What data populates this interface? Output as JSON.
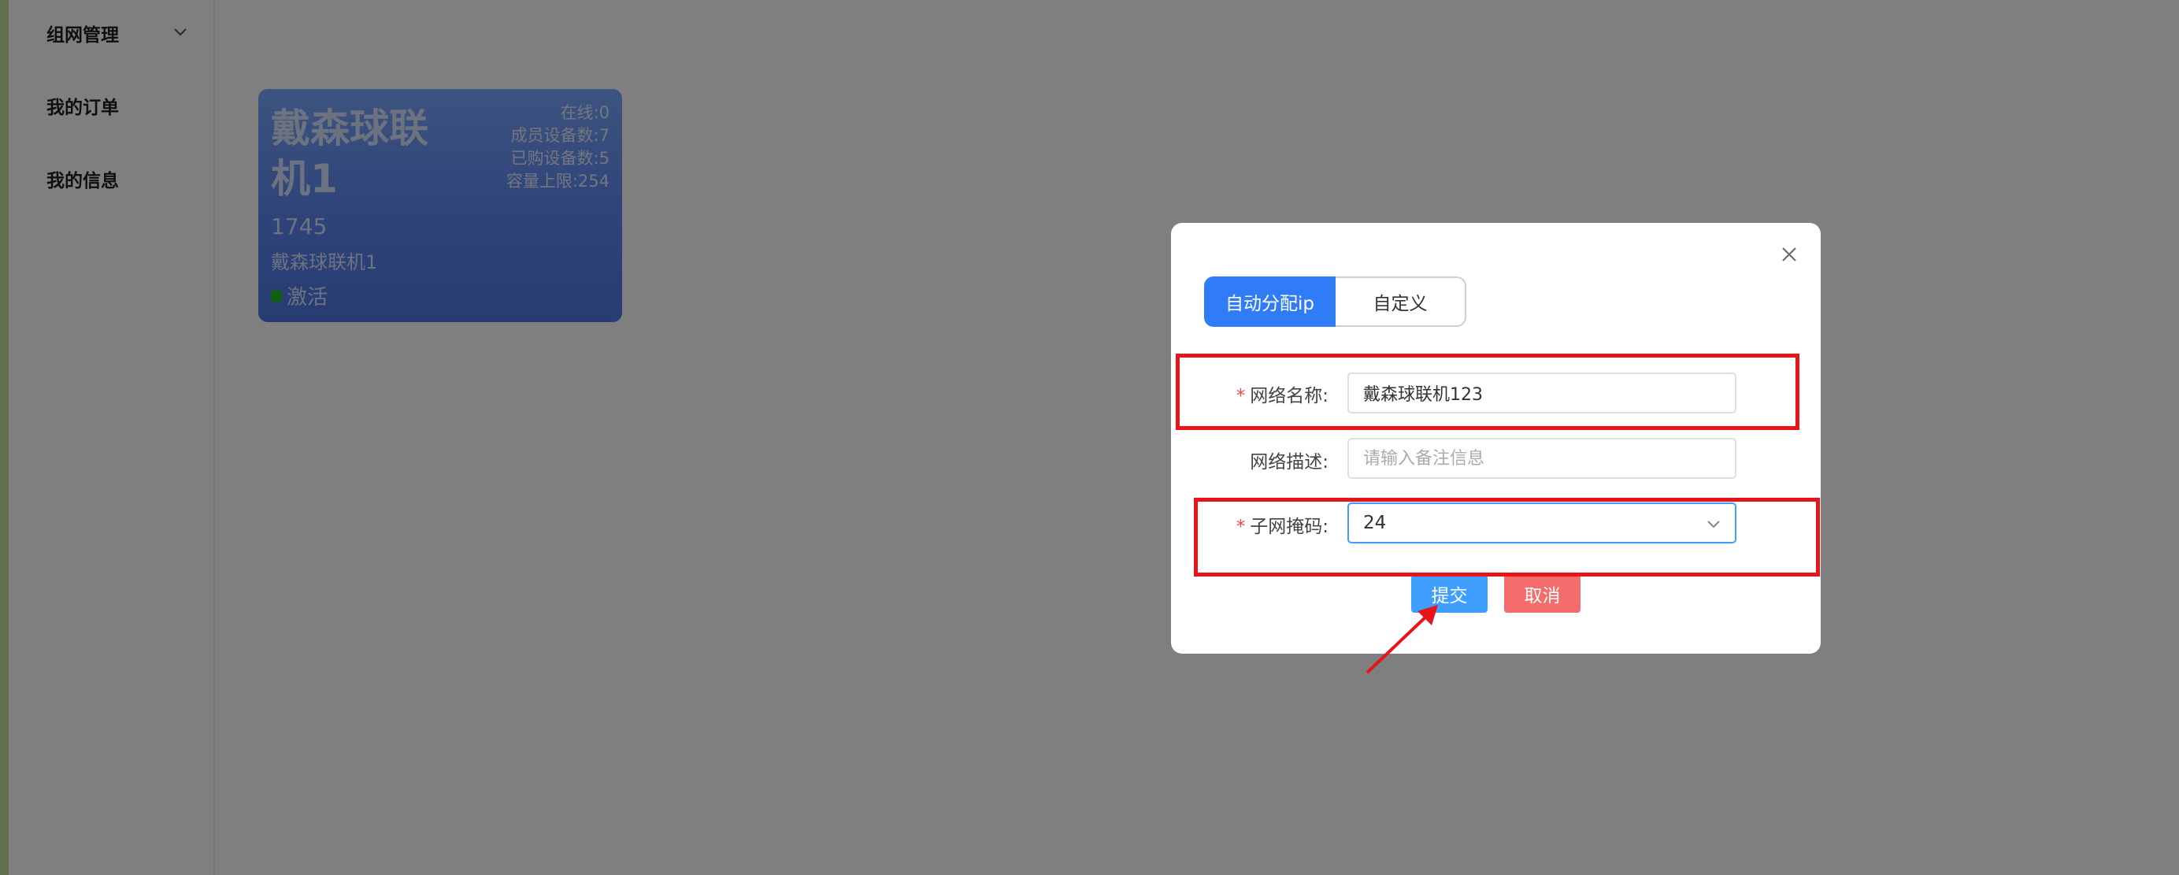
{
  "sidebar": {
    "items": [
      {
        "label": "组网管理",
        "icon": "chevron-down-icon"
      },
      {
        "label": "我的订单"
      },
      {
        "label": "我的信息"
      }
    ]
  },
  "network_card": {
    "title": "戴森球联机1",
    "id": "1745",
    "description": "戴森球联机1",
    "status": "激活",
    "status_color": "#1fc21f",
    "stats": {
      "online": "在线:0",
      "members": "成员设备数:7",
      "purchased": "已购设备数:5",
      "capacity": "容量上限:254"
    }
  },
  "dialog": {
    "tabs": {
      "auto": "自动分配ip",
      "custom": "自定义",
      "active": "自动分配ip"
    },
    "fields": {
      "name": {
        "label": "网络名称:",
        "value": "戴森球联机123",
        "required": true
      },
      "desc": {
        "label": "网络描述:",
        "placeholder": "请输入备注信息",
        "required": false
      },
      "subnet": {
        "label": "子网掩码:",
        "value": "24",
        "required": true
      }
    },
    "required_mark": "*",
    "buttons": {
      "submit": "提交",
      "cancel": "取消"
    }
  },
  "colors": {
    "primary": "#409eff",
    "danger": "#f56c6c",
    "annotation": "#e8141a",
    "card": "#5a86f2"
  }
}
